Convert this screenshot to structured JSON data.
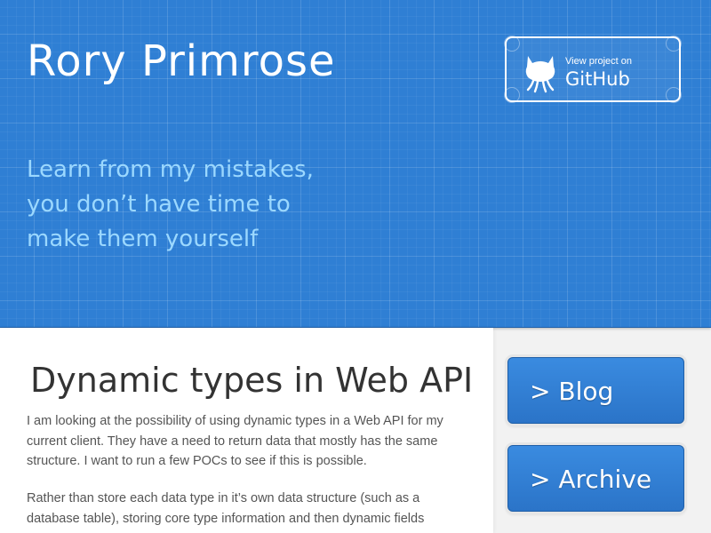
{
  "header": {
    "title": "Rory Primrose",
    "tagline": "Learn from my mistakes, you don’t have time to make them yourself",
    "github_button": {
      "small_label": "View project on",
      "big_label": "GitHub",
      "icon": "octocat-icon"
    }
  },
  "article": {
    "title": "Dynamic types in Web API",
    "paragraphs": [
      "I am looking at the possibility of using dynamic types in a Web API for my current client. They have a need to return data that mostly has the same structure. I want to run a few POCs to see if this is possible.",
      "Rather than store each data type in it’s own data structure (such as a database table), storing core type information and then dynamic fields"
    ]
  },
  "sidebar": {
    "items": [
      {
        "label": "> Blog"
      },
      {
        "label": "> Archive"
      }
    ]
  },
  "colors": {
    "header_blue": "#2f7fd4",
    "tagline": "#9bd8ff",
    "nav_button": "#2b74c8"
  }
}
